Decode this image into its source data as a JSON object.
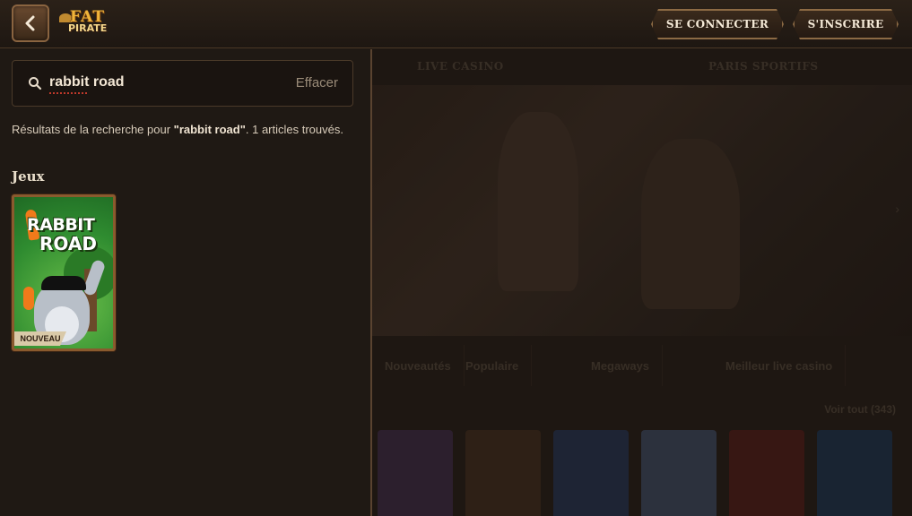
{
  "header": {
    "back_label": "back",
    "logo_line1": "FAT",
    "logo_line2": "PIRATE",
    "login_label": "SE CONNECTER",
    "signup_label": "S'INSCRIRE"
  },
  "search": {
    "query": "rabbit road",
    "clear_label": "Effacer",
    "results_prefix": "Résultats de la recherche pour ",
    "results_query": "\"rabbit road\"",
    "results_suffix": ". 1 articles trouvés."
  },
  "games": {
    "section_title": "Jeux",
    "items": [
      {
        "title_line1": "RABBIT",
        "title_line2": "ROAD",
        "badge": "NOUVEAU"
      }
    ]
  },
  "background": {
    "tabs": [
      "LIVE CASINO",
      "PARIS SPORTIFS"
    ],
    "categories": [
      "Nouveautés",
      "Populaire",
      "Megaways",
      "Meilleur live casino"
    ],
    "view_all": "Voir tout (343)",
    "thumb_colors": [
      "#3a2840",
      "#3c2a1c",
      "#24304a",
      "#3a4458",
      "#4a1c18",
      "#1c3048"
    ]
  }
}
